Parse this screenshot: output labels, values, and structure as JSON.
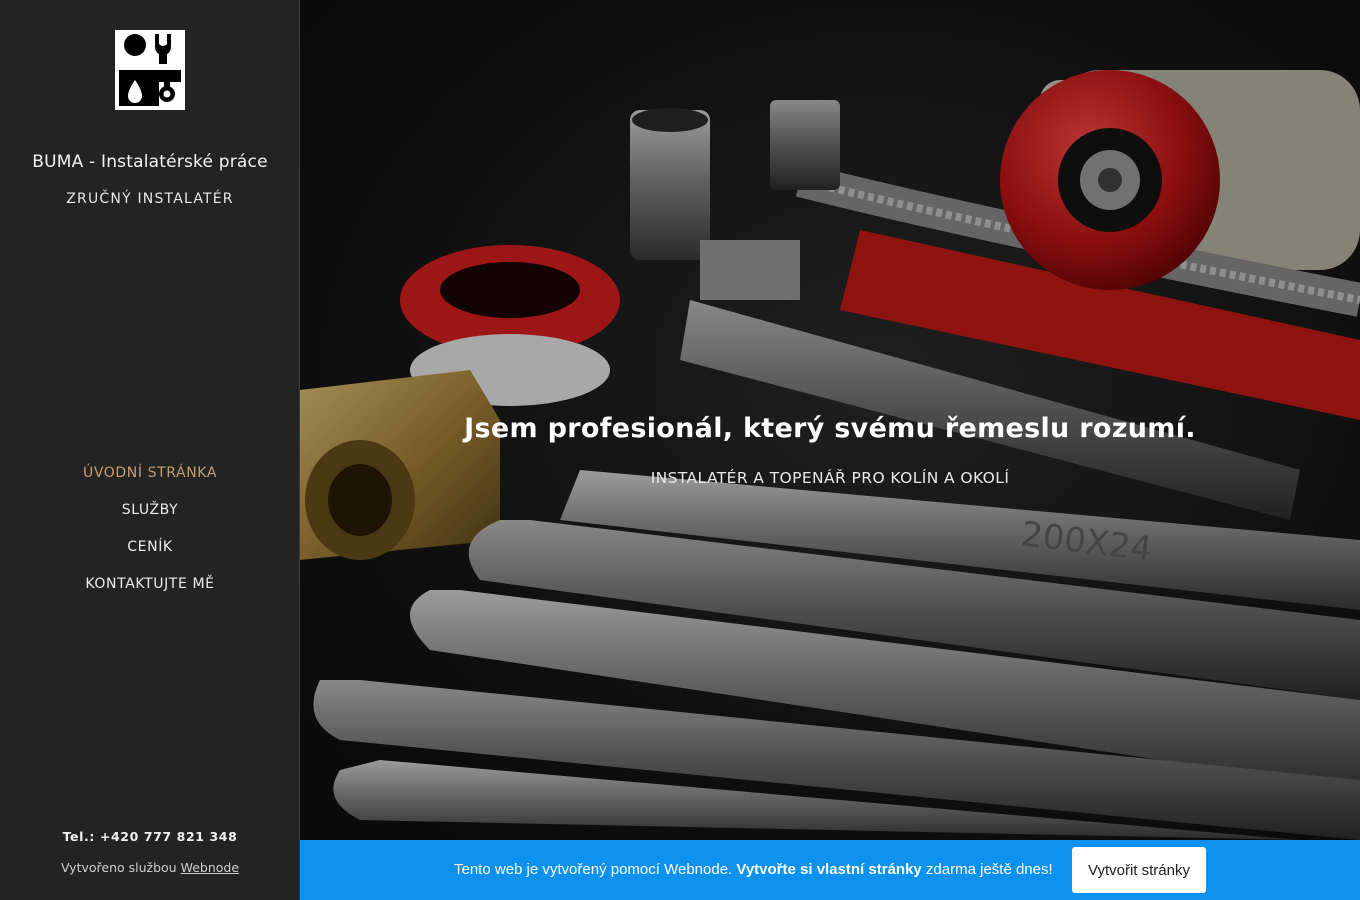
{
  "site": {
    "title": "BUMA - Instalatérské práce",
    "subtitle": "ZRUČNÝ INSTALATÉR",
    "logo_icon": "plumber-wrench-logo-icon"
  },
  "nav": {
    "items": [
      {
        "label": "ÚVODNÍ STRÁNKA",
        "active": true
      },
      {
        "label": "SLUŽBY",
        "active": false
      },
      {
        "label": "CENÍK",
        "active": false
      },
      {
        "label": "KONTAKTUJTE MĚ",
        "active": false
      }
    ],
    "active_color": "#c79d73"
  },
  "footer": {
    "phone": "Tel.: +420 777 821 348",
    "credit_prefix": "Vytvořeno službou ",
    "credit_link": "Webnode"
  },
  "hero": {
    "title": "Jsem profesionál, který svému řemeslu rozumí.",
    "subtitle": "INSTALATÉR A TOPENÁŘ PRO KOLÍN A OKOLÍ",
    "wrench_mark": "200X24"
  },
  "promo": {
    "text_start": "Tento web je vytvořený pomocí Webnode. ",
    "text_bold": "Vytvořte si vlastní stránky",
    "text_end": " zdarma ještě dnes!",
    "button_label": "Vytvořit stránky",
    "background": "#0c91ee"
  }
}
